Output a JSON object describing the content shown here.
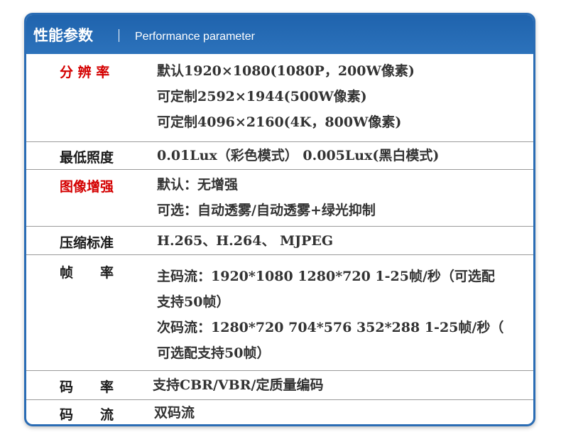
{
  "header": {
    "title": "性能参数",
    "subtitle": "Performance parameter"
  },
  "colors": {
    "header_bg": "#2a6cb4",
    "highlight_label": "#d40000",
    "label": "#1a1a1a",
    "value": "#333333"
  },
  "rows": [
    {
      "label": "分 辨 率",
      "highlight": true,
      "lines": [
        "默认1920×1080(1080P，200W像素)",
        "可定制2592×1944(500W像素)",
        "可定制4096×2160(4K，800W像素)"
      ]
    },
    {
      "label": "最低照度",
      "highlight": false,
      "lines": [
        "0.01Lux（彩色模式）  0.005Lux(黑白模式)"
      ]
    },
    {
      "label": "图像增强",
      "highlight": true,
      "lines": [
        "默认：无增强",
        "可选：自动透雾/自动透雾+绿光抑制"
      ]
    },
    {
      "label": "压缩标准",
      "highlight": false,
      "lines": [
        "H.265、H.264、 MJPEG"
      ]
    },
    {
      "label": "帧　　率",
      "highlight": false,
      "lines": [
        "主码流：1920*1080 1280*720 1-25帧/秒（可选配",
        "支持50帧）",
        "次码流：1280*720 704*576 352*288 1-25帧/秒（",
        "可选配支持50帧）"
      ]
    },
    {
      "label": "码　　率",
      "highlight": false,
      "lines": [
        "支持CBR/VBR/定质量编码"
      ]
    },
    {
      "label": "码　　流",
      "highlight": false,
      "lines": [
        "双码流"
      ]
    }
  ]
}
